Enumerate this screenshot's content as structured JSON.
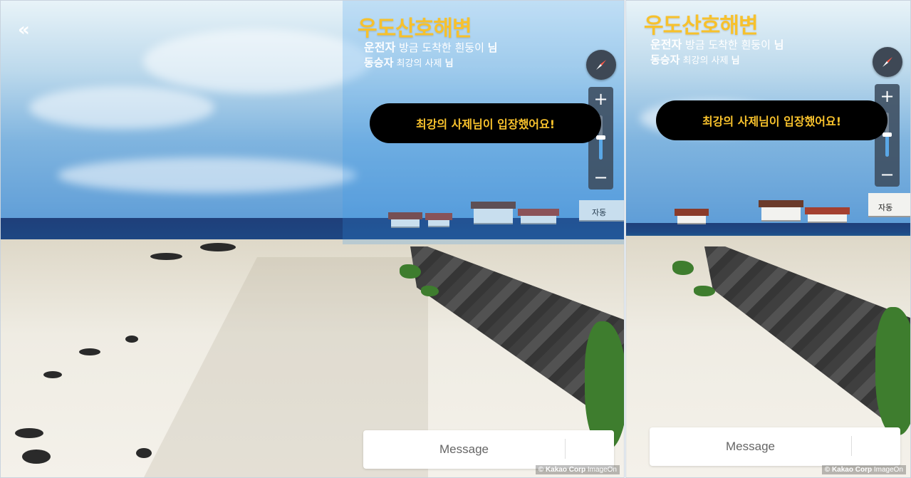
{
  "location": {
    "name": "우도산호해변"
  },
  "roles": {
    "driver_label": "운전자",
    "driver_name": "방금 도착한 흰둥이",
    "passenger_label": "동승자",
    "passenger_name": "최강의 사제",
    "suffix": "님"
  },
  "toast": {
    "message": "최강의 사제님이 입장했어요!"
  },
  "message": {
    "placeholder": "Message"
  },
  "zoom": {
    "in_label": "+",
    "out_label": "−",
    "level": 0.5
  },
  "scene": {
    "sign_text": "자동"
  },
  "credit": {
    "corp": "© Kakao Corp",
    "provider": "ImageOn"
  },
  "nav": {
    "back_label": "«"
  },
  "colors": {
    "title": "#f7c12c",
    "toast_bg": "#000000",
    "control_bg": "#3e4855"
  },
  "icons": {
    "back": "double-chevron-left-icon",
    "compass": "compass-icon"
  }
}
